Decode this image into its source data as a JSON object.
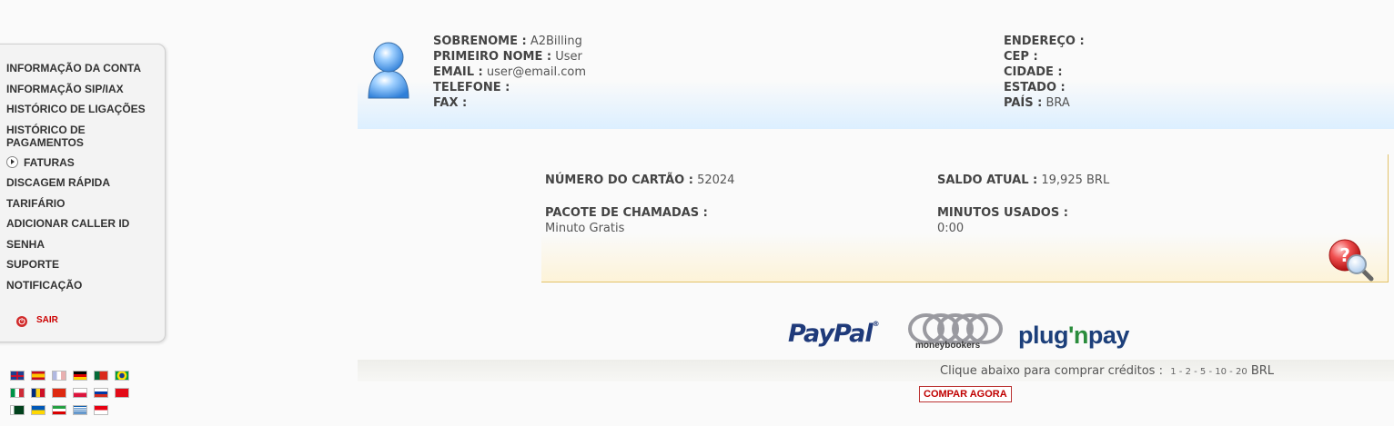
{
  "sidebar": {
    "items": [
      {
        "label": "INFORMAÇÃO DA CONTA"
      },
      {
        "label": "INFORMAÇÃO SIP/IAX"
      },
      {
        "label": "HISTÓRICO DE LIGAÇÕES"
      },
      {
        "label": "HISTÓRICO DE PAGAMENTOS"
      },
      {
        "label": "FATURAS",
        "icon": "arrow-circle-icon"
      },
      {
        "label": "DISCAGEM RÁPIDA"
      },
      {
        "label": "TARIFÁRIO"
      },
      {
        "label": "ADICIONAR CALLER ID"
      },
      {
        "label": "SENHA"
      },
      {
        "label": "SUPORTE"
      },
      {
        "label": "NOTIFICAÇÃO"
      }
    ],
    "logout_label": "SAIR"
  },
  "languages": [
    "english",
    "spanish",
    "french",
    "german",
    "portuguese",
    "brazilian",
    "italian",
    "romanian",
    "chinese",
    "polish",
    "russian",
    "turkish",
    "urdu",
    "ukrainian",
    "farsi",
    "greek",
    "indonesian"
  ],
  "profile": {
    "sobrenome_label": "SOBRENOME :",
    "sobrenome": "A2Billing",
    "primeiro_nome_label": "PRIMEIRO NOME :",
    "primeiro_nome": "User",
    "email_label": "EMAIL :",
    "email": "user@email.com",
    "telefone_label": "TELEFONE :",
    "telefone": "",
    "fax_label": "FAX :",
    "fax": "",
    "endereco_label": "ENDEREÇO :",
    "endereco": "",
    "cep_label": "CEP :",
    "cep": "",
    "cidade_label": "CIDADE :",
    "cidade": "",
    "estado_label": "ESTADO :",
    "estado": "",
    "pais_label": "PAÍS :",
    "pais": "BRA"
  },
  "card": {
    "numero_label": "NÚMERO DO CARTÃO :",
    "numero": "52024",
    "saldo_label": "SALDO ATUAL :",
    "saldo": "19,925 BRL",
    "pacote_label": "PACOTE DE CHAMADAS :",
    "pacote": "Minuto Gratis",
    "minutos_label": "MINUTOS USADOS :",
    "minutos": "0:00"
  },
  "payment": {
    "paypal": "PayPal",
    "paypal_reg": "®",
    "moneybookers": "moneybookers",
    "plugnpay_a": "plug",
    "plugnpay_b": "'n",
    "plugnpay_c": "pay",
    "buy_prompt": "Clique abaixo para comprar créditos :",
    "amounts": [
      "1",
      "2",
      "5",
      "10",
      "20"
    ],
    "currency": "BRL",
    "buy_button": "COMPAR AGORA"
  },
  "colors": {
    "accent_red": "#c00000",
    "header_gradient": "#dcefff",
    "card_gradient": "#fdf3d8"
  }
}
